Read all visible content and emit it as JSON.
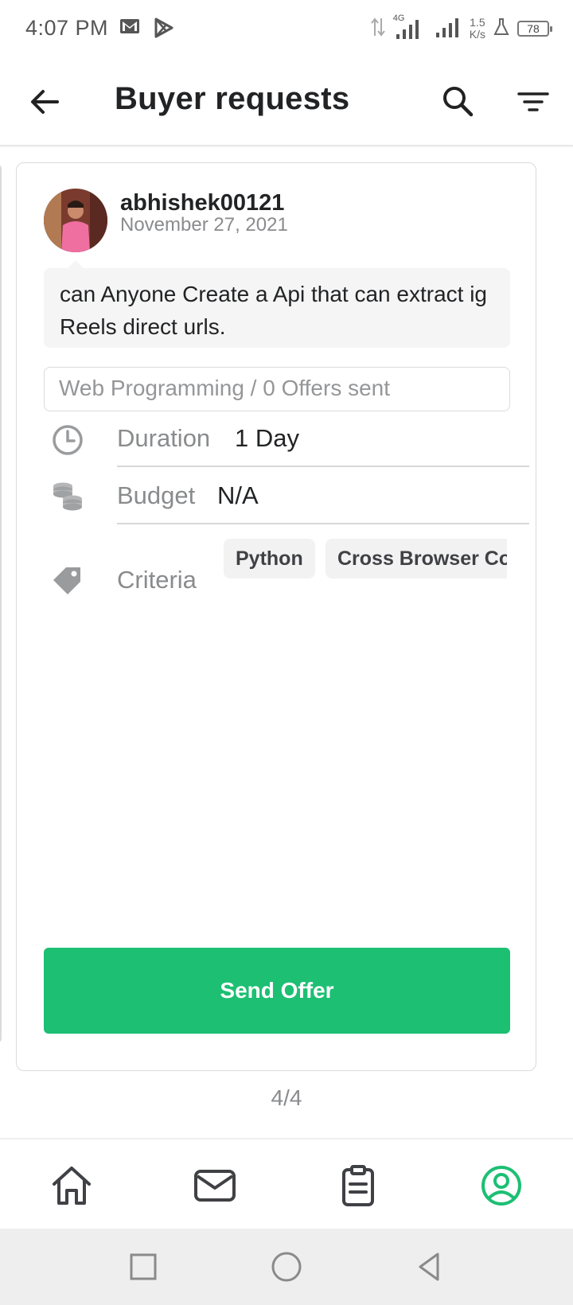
{
  "status_bar": {
    "time": "4:07 PM",
    "network": "4G",
    "speed_value": "1.5",
    "speed_unit": "K/s",
    "battery": "78"
  },
  "app_bar": {
    "title": "Buyer requests"
  },
  "request": {
    "username": "abhishek00121",
    "date": "November 27, 2021",
    "description": "can Anyone Create a Api that can extract ig Reels direct urls.",
    "category_line": "Web Programming / 0 Offers sent",
    "duration_label": "Duration",
    "duration_value": "1 Day",
    "budget_label": "Budget",
    "budget_value": "N/A",
    "criteria_label": "Criteria",
    "criteria": [
      "Python",
      "Cross Browser Compatibility"
    ],
    "send_button": "Send Offer"
  },
  "pager": "4/4",
  "colors": {
    "accent": "#1dbf73",
    "text_primary": "#222325",
    "text_secondary": "#8a8b8d"
  },
  "bottom_nav": [
    "home-icon",
    "inbox-icon",
    "orders-icon",
    "profile-icon"
  ],
  "bottom_nav_active": "profile-icon"
}
